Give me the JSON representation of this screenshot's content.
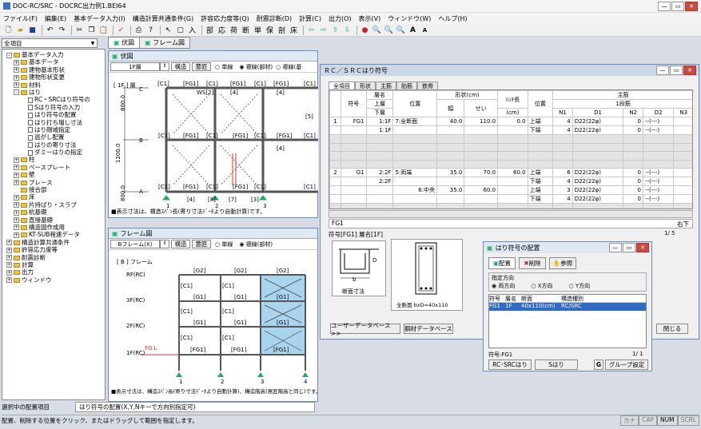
{
  "app": {
    "title": "DOC-RC/SRC - DOCRC出力例1.BEI64"
  },
  "menu": [
    "ファイル(F)",
    "編集(E)",
    "基本データ入力(I)",
    "構造計算共通条件(G)",
    "許容応力度等(Q)",
    "耐震診断(D)",
    "計算(C)",
    "出力(O)",
    "表示(V)",
    "ウィンドウ(W)",
    "ヘルプ(H)"
  ],
  "toolbar": {
    "text_buttons": [
      "部",
      "応",
      "荷",
      "断",
      "単",
      "保",
      "剖",
      "床"
    ]
  },
  "sidebar": {
    "dropdown": "全項目",
    "tree": [
      {
        "l": 0,
        "t": "folder",
        "pm": "-",
        "label": "基本データ入力"
      },
      {
        "l": 1,
        "t": "folder",
        "pm": "+",
        "label": "基本データ"
      },
      {
        "l": 1,
        "t": "folder",
        "pm": "+",
        "label": "建物基本形状"
      },
      {
        "l": 1,
        "t": "folder",
        "pm": "+",
        "label": "建物形状変更"
      },
      {
        "l": 1,
        "t": "folder",
        "pm": "+",
        "label": "材料"
      },
      {
        "l": 1,
        "t": "folder",
        "pm": "-",
        "label": "はり"
      },
      {
        "l": 2,
        "t": "doc",
        "pm": "",
        "label": "RC・SRCはり符号の"
      },
      {
        "l": 2,
        "t": "doc",
        "pm": "",
        "label": "Sはり符号の入力"
      },
      {
        "l": 2,
        "t": "doc",
        "pm": "",
        "label": "はり符号の配置"
      },
      {
        "l": 2,
        "t": "doc",
        "pm": "",
        "label": "はり打ち増し寸法"
      },
      {
        "l": 2,
        "t": "doc",
        "pm": "",
        "label": "はり剛域指定"
      },
      {
        "l": 2,
        "t": "doc",
        "pm": "",
        "label": "逃がし配置"
      },
      {
        "l": 2,
        "t": "doc",
        "pm": "",
        "label": "はりの寄り寸法"
      },
      {
        "l": 2,
        "t": "doc",
        "pm": "",
        "label": "ダミーはりの指定"
      },
      {
        "l": 1,
        "t": "folder",
        "pm": "+",
        "label": "柱"
      },
      {
        "l": 1,
        "t": "folder",
        "pm": "+",
        "label": "ベースプレート"
      },
      {
        "l": 1,
        "t": "folder",
        "pm": "+",
        "label": "壁"
      },
      {
        "l": 1,
        "t": "folder",
        "pm": "+",
        "label": "ブレース"
      },
      {
        "l": 1,
        "t": "folder",
        "pm": "",
        "label": "接合部"
      },
      {
        "l": 1,
        "t": "folder",
        "pm": "+",
        "label": "床"
      },
      {
        "l": 1,
        "t": "folder",
        "pm": "+",
        "label": "片持ばり・スラブ"
      },
      {
        "l": 1,
        "t": "folder",
        "pm": "+",
        "label": "杭基礎"
      },
      {
        "l": 1,
        "t": "folder",
        "pm": "+",
        "label": "直接基礎"
      },
      {
        "l": 1,
        "t": "folder",
        "pm": "+",
        "label": "構造図作成用"
      },
      {
        "l": 1,
        "t": "folder",
        "pm": "+",
        "label": "KT-SUB程連データ"
      },
      {
        "l": 0,
        "t": "folder",
        "pm": "+",
        "label": "構造計算共通条件"
      },
      {
        "l": 0,
        "t": "folder",
        "pm": "+",
        "label": "許容応力度等"
      },
      {
        "l": 0,
        "t": "folder",
        "pm": "+",
        "label": "耐震診断"
      },
      {
        "l": 0,
        "t": "folder",
        "pm": "+",
        "label": "計算"
      },
      {
        "l": 0,
        "t": "folder",
        "pm": "+",
        "label": "出力"
      },
      {
        "l": 0,
        "t": "folder",
        "pm": "+",
        "label": "ウィンドウ"
      }
    ]
  },
  "tabs": [
    "伏図",
    "フレーム図"
  ],
  "plan": {
    "title": "伏図",
    "floor": "1F層",
    "btn_struct": "構造",
    "btn_intention": "意匠",
    "radio1": "単線",
    "radio2": "複線(部材)",
    "radio3": "複線(基",
    "caption": "[ 1F ] 層",
    "note": "■表示寸法は、構造ｽﾊﾟﾝ長(寄り寸法ﾃﾞｰﾀより自動計算)です。",
    "dims": [
      "800.0",
      "1200.0",
      "800.0"
    ],
    "axes_y": [
      "C",
      "B",
      "A"
    ],
    "axes_x": [
      "1",
      "2",
      "3",
      "4"
    ],
    "labels": {
      "c1": "[C1]",
      "fg1": "[FG1]",
      "fg2": "[FG2]",
      "n4": "[4]",
      "n5": "[5]",
      "n7": "[7]",
      "n8": "[8]",
      "n3": "[3]",
      "ws2": "WS[2]",
      "fg": "[FG]"
    }
  },
  "frame": {
    "title": "フレーム図",
    "frame_sel": "Bフレーム(X)",
    "btn_struct": "構造",
    "btn_intention": "意匠",
    "radio1": "単線",
    "radio2": "複線(部材)",
    "caption": "[ B ] フレーム",
    "note": "■表示寸法は、構造ｽﾊﾟﾝ長(寄り寸法ﾃﾞｰﾀより自動計算)、構造階高(意匠階高と同じ)です。",
    "floors": [
      "RF(RC)",
      "3F(RC)",
      "2F(RC)",
      "1F(RC)"
    ],
    "gl": "FG.L",
    "axes": [
      "1",
      "2",
      "3",
      "4"
    ],
    "labels": {
      "g2": "[G2]",
      "g1": "[G1]",
      "fg1": "[FG1]",
      "c1": "[C1]"
    }
  },
  "beam_dialog": {
    "title": "ＲＣ／ＳＲＣはり符号",
    "tabs": [
      "全項目",
      "形状",
      "主筋",
      "肋筋",
      "鉄骨"
    ],
    "headers": {
      "code": "符号",
      "floor": "層名",
      "floor_up": "上層",
      "floor_low": "下層",
      "pos": "位置",
      "shape": "形状(cm)",
      "width": "幅",
      "depth": "せい",
      "haunch": "ﾊﾝﾁ長",
      "cm": "(cm)",
      "pos2": "位置",
      "main": "主筋",
      "row1": "1段筋",
      "n1": "N1",
      "d1": "D1",
      "n2": "N2",
      "d2": "D2",
      "n3": "N3"
    },
    "rows": [
      {
        "no": "1",
        "code": "FG1",
        "up": "1:1F",
        "low": "1:1F",
        "pos": "7:全断面",
        "b": "40.0",
        "d": "110.0",
        "h": "0.0",
        "p": [
          "上端",
          "下端"
        ],
        "n1": [
          "4",
          "4"
        ],
        "d1": [
          "D22(22φ)",
          "D22(22φ)"
        ],
        "n2": [
          "0",
          "0"
        ],
        "d2": [
          "--(---)",
          "--(---)"
        ]
      },
      {
        "no": "2",
        "code": "G1",
        "up": "2:2F",
        "low": "2:2F",
        "pos": "5:両端",
        "b": "35.0",
        "d": "70.0",
        "h": "60.0",
        "p": [
          "上端",
          "下端",
          "上端",
          "下端"
        ],
        "n1": [
          "6",
          "4",
          "3",
          "4"
        ],
        "d1": [
          "D22(22φ)",
          "D22(22φ)",
          "D22(22φ)",
          "D22(22φ)"
        ],
        "n2": [
          "0",
          "0",
          "0",
          "0"
        ],
        "d2": [
          "--(---)",
          "--(---)",
          "--(---)",
          "--(---)"
        ],
        "pos2": "6:中央",
        "b2": "35.0",
        "d2v": "60.0"
      }
    ],
    "current": "FG1",
    "bottom_label": "右下",
    "page": "1/ 5",
    "subtitle": "符号[FG1] 層名[1F]",
    "section_caption": "断面寸法",
    "section_caption2": "全断面 bxD=40x110",
    "b_lbl": "b",
    "d_lbl": "D",
    "btn_user": "ユーザーデータベース >>",
    "btn_steel": "鋼材データベース",
    "btn_close": "閉じる"
  },
  "place_dialog": {
    "title": "はり符号の配置",
    "tab_place": "配置",
    "tab_delete": "削除",
    "tab_ref": "参照",
    "dir_label": "指定方向",
    "dirs": [
      "両方向",
      "X方向",
      "Y方向"
    ],
    "headers": [
      "符号",
      "層名",
      "断面",
      "構造種別"
    ],
    "row": [
      "FG1",
      "1F",
      "40x110(cm)",
      "RC/SRC"
    ],
    "code_label": "符号:FG1",
    "page": "1/ 1",
    "btn_rc": "RC･SRCはり",
    "btn_s": "Sはり",
    "btn_g": "G",
    "btn_group": "グループ設定"
  },
  "status": {
    "label": "選択中の配置項目",
    "value": "はり符号の配置(X,Y,Nキーで方向別指定可)",
    "message": "配置、削除する位置をクリック、またはドラッグして範囲を指定します。",
    "kana": "カナ",
    "cap": "CAP",
    "num": "NUM",
    "scrl": "SCRL"
  }
}
